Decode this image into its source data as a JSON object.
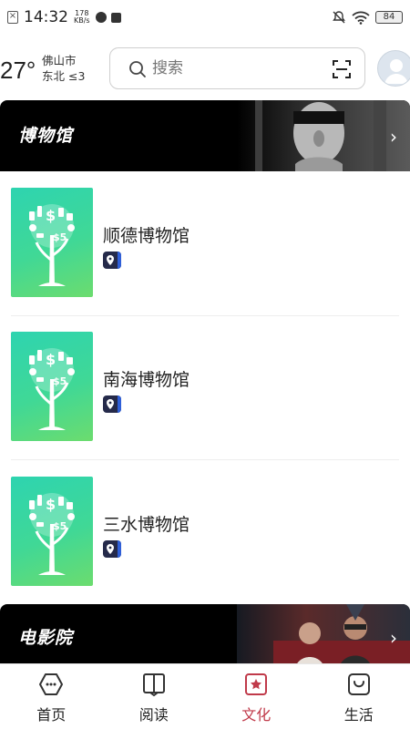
{
  "status_bar": {
    "time": "14:32",
    "speed_value": "178",
    "speed_unit": "KB/s",
    "battery": "84"
  },
  "header": {
    "temperature": "27°",
    "city": "佛山市",
    "wind": "东北 ≤3",
    "search_placeholder": "搜索"
  },
  "sections": {
    "museum_title": "博物馆",
    "cinema_title": "电影院"
  },
  "museums": [
    {
      "name": "顺德博物馆"
    },
    {
      "name": "南海博物馆"
    },
    {
      "name": "三水博物馆"
    }
  ],
  "tabs": [
    {
      "label": "首页",
      "icon": "home-icon"
    },
    {
      "label": "阅读",
      "icon": "book-icon"
    },
    {
      "label": "文化",
      "icon": "culture-star-icon",
      "active": true
    },
    {
      "label": "生活",
      "icon": "bag-icon"
    }
  ],
  "colors": {
    "accent_active": "#c03a4a",
    "thumb_gradient_start": "#2ed4b0",
    "thumb_gradient_end": "#6cdc6e",
    "banner_bg": "#000000"
  }
}
